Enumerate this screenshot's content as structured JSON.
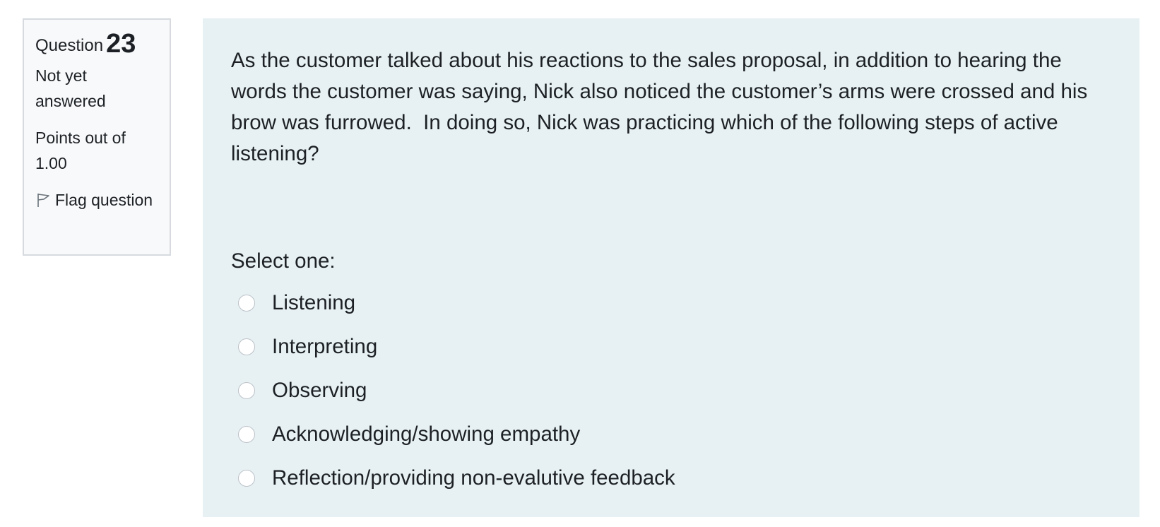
{
  "question_info": {
    "question_label": "Question",
    "question_number": "23",
    "status": "Not yet answered",
    "points": "Points out of 1.00",
    "flag_label": "Flag question",
    "flag_icon": "flag-outline-icon"
  },
  "question": {
    "text": "As the customer talked about his reactions to the sales proposal, in addition to hearing the words the customer was saying, Nick also noticed the customer’s arms were crossed and his brow was furrowed.  In doing so, Nick was practicing which of the following steps of active listening?",
    "prompt": "Select one:",
    "options": [
      {
        "label": "Listening",
        "selected": false
      },
      {
        "label": "Interpreting",
        "selected": false
      },
      {
        "label": "Observing",
        "selected": false
      },
      {
        "label": "Acknowledging/showing empathy",
        "selected": false
      },
      {
        "label": "Reflection/providing non-evalutive feedback",
        "selected": false
      }
    ]
  },
  "colors": {
    "content_background": "#e7f1f4",
    "info_background": "#f8f9fa",
    "info_border": "#d7dbdf",
    "text": "#1d2125"
  }
}
